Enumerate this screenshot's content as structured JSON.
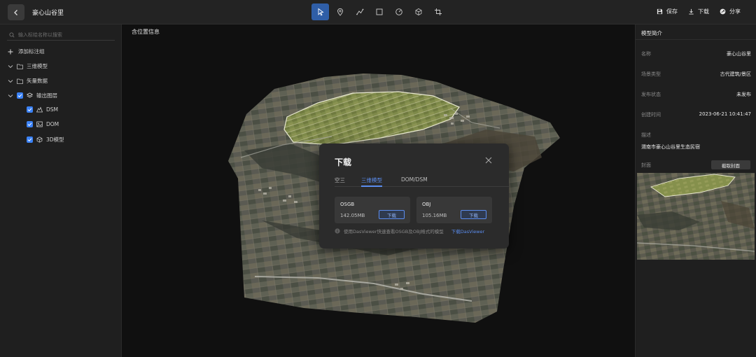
{
  "header": {
    "title": "豪心山谷里",
    "tools": [
      "select-icon",
      "location-pin-icon",
      "polyline-icon",
      "rectangle-icon",
      "measure-icon",
      "cube-icon",
      "crop-icon"
    ],
    "actions": [
      {
        "label": "保存",
        "icon": "save-icon"
      },
      {
        "label": "下载",
        "icon": "download-icon"
      },
      {
        "label": "分享",
        "icon": "share-icon"
      }
    ]
  },
  "sidebar": {
    "search_placeholder": "输入标绘名称以搜索",
    "add_group": "添加标注组",
    "items": [
      {
        "label": "三维模型",
        "icon": "folder-icon"
      },
      {
        "label": "矢量数据",
        "icon": "folder-icon"
      },
      {
        "label": "输出图层",
        "icon": "layers-icon",
        "checked": true
      },
      {
        "label": "DSM",
        "icon": "terrain-icon",
        "checked": true
      },
      {
        "label": "DOM",
        "icon": "image-icon",
        "checked": true
      },
      {
        "label": "3D模型",
        "icon": "cube-icon",
        "checked": true
      }
    ]
  },
  "map": {
    "label": "含位置信息"
  },
  "panel": {
    "title": "模型简介",
    "rows": [
      {
        "label": "名称",
        "value": "豪心山谷里"
      },
      {
        "label": "场景类型",
        "value": "古代建筑/景区"
      },
      {
        "label": "发布状态",
        "value": "未发布"
      },
      {
        "label": "创建时间",
        "value": "2023-06-21 10:41:47"
      }
    ],
    "desc_label": "描述",
    "desc_value": "渭南市豪心山谷里生态民宿",
    "cover_label": "封面",
    "cover_button": "截取封面"
  },
  "modal": {
    "title": "下载",
    "tabs": [
      "空三",
      "三维模型",
      "DOM/DSM"
    ],
    "active_tab": "三维模型",
    "cards": [
      {
        "name": "OSGB",
        "size": "142.05MB",
        "button": "下载"
      },
      {
        "name": "OBJ",
        "size": "105.16MB",
        "button": "下载"
      }
    ],
    "hint": "使用DasViewer快速查看OSGB及OBJ格式的模型",
    "hint_link": "下载DasViewer"
  },
  "colors": {
    "accent": "#5b8def",
    "active_tool": "#2f5ea7",
    "checkbox": "#3b82f6"
  }
}
